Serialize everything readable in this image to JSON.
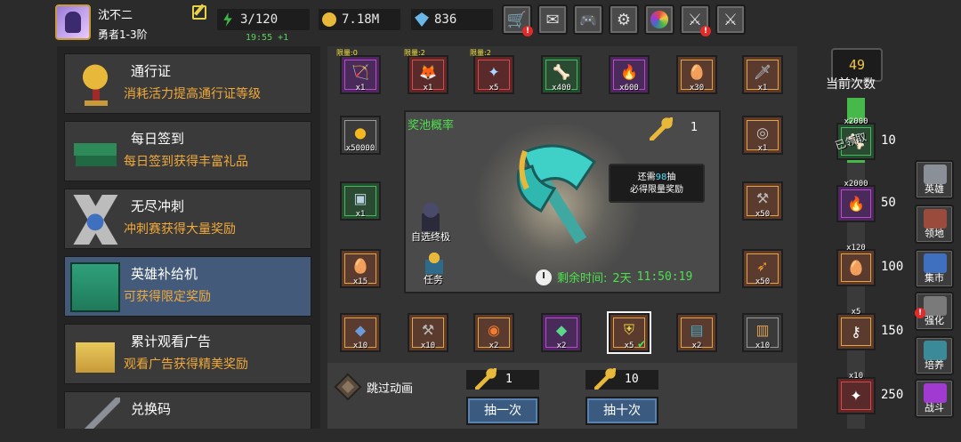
{
  "header": {
    "player_name": "沈不二",
    "player_rank": "勇者1-3阶",
    "energy": "3/120",
    "energy_timer": "19:55 +1",
    "gold": "7.18M",
    "gems": "836",
    "icons": [
      "edit-icon",
      "energy-icon",
      "gold-icon",
      "gem-icon",
      "shop-cart-icon",
      "mail-icon",
      "gamepad-icon",
      "gear-icon",
      "color-wheel-icon",
      "broken-sword-icon",
      "crossed-swords-icon"
    ]
  },
  "menu": {
    "items": [
      {
        "title": "通行证",
        "desc": "消耗活力提高通行证等级"
      },
      {
        "title": "每日签到",
        "desc": "每日签到获得丰富礼品"
      },
      {
        "title": "无尽冲刺",
        "desc": "冲刺赛获得大量奖励"
      },
      {
        "title": "英雄补给机",
        "desc": "可获得限定奖励"
      },
      {
        "title": "累计观看广告",
        "desc": "观看广告获得精美奖励"
      },
      {
        "title": "兑换码",
        "desc": ""
      }
    ]
  },
  "grid": {
    "top": [
      {
        "limit": "限量:0",
        "qty": "x1",
        "rarity": "purple",
        "icon": "crossbow-icon"
      },
      {
        "limit": "限量:2",
        "qty": "x1",
        "rarity": "red",
        "icon": "fox-mask-icon"
      },
      {
        "limit": "限量:2",
        "qty": "x5",
        "rarity": "red",
        "icon": "crystal-icon"
      },
      {
        "limit": "",
        "qty": "x400",
        "rarity": "green",
        "icon": "bone-icon"
      },
      {
        "limit": "",
        "qty": "x600",
        "rarity": "purple",
        "icon": "flame-gem-icon"
      },
      {
        "limit": "",
        "qty": "x30",
        "rarity": "orange",
        "icon": "golden-egg-icon"
      },
      {
        "limit": "",
        "qty": "x1",
        "rarity": "orange",
        "icon": "dagger-icon"
      }
    ],
    "left": [
      {
        "qty": "x50000",
        "rarity": "grey",
        "icon": "gold-coin-icon"
      },
      {
        "qty": "x1",
        "rarity": "green",
        "icon": "treasure-chest-icon"
      },
      {
        "qty": "x15",
        "rarity": "orange",
        "icon": "golden-egg-icon"
      }
    ],
    "right": [
      {
        "qty": "x1",
        "rarity": "orange",
        "icon": "ring-icon"
      },
      {
        "qty": "x50",
        "rarity": "orange",
        "icon": "hammer-icon"
      },
      {
        "qty": "x50",
        "rarity": "orange",
        "icon": "feather-icon"
      }
    ],
    "bottom": [
      {
        "qty": "x10",
        "rarity": "orange",
        "icon": "ore-icon"
      },
      {
        "qty": "x10",
        "rarity": "orange",
        "icon": "hammer-icon"
      },
      {
        "qty": "x2",
        "rarity": "orange",
        "icon": "fire-orb-icon"
      },
      {
        "qty": "x2",
        "rarity": "purple",
        "icon": "green-gem-icon"
      },
      {
        "qty": "x5",
        "rarity": "orange",
        "icon": "shield-icon"
      },
      {
        "qty": "x2",
        "rarity": "orange",
        "icon": "skill-book-icon"
      },
      {
        "qty": "x10",
        "rarity": "grey",
        "icon": "scroll-book-icon"
      }
    ]
  },
  "pool": {
    "title": "奖池概率",
    "key_count": "1",
    "tooltip_prefix": "还需",
    "tooltip_num": "98",
    "tooltip_suffix": "抽",
    "tooltip_line2": "必得限量奖励",
    "char1_label": "自选终极",
    "char2_label": "任务",
    "timer_label": "剩余时间:",
    "timer_days": "2天",
    "timer_value": "11:50:19"
  },
  "actions": {
    "skip_label": "跳过动画",
    "single_cost": "1",
    "ten_cost": "10",
    "single_label": "抽一次",
    "ten_label": "抽十次"
  },
  "progress": {
    "count": "49",
    "count_label": "当前次数",
    "milestones": [
      {
        "num": "10",
        "qty": "x2000",
        "rarity": "green",
        "claimed": "已领取"
      },
      {
        "num": "50",
        "qty": "x2000",
        "rarity": "purple",
        "claimed": ""
      },
      {
        "num": "100",
        "qty": "x120",
        "rarity": "orange",
        "claimed": ""
      },
      {
        "num": "150",
        "qty": "x5",
        "rarity": "orange",
        "claimed": ""
      },
      {
        "num": "250",
        "qty": "x10",
        "rarity": "red",
        "claimed": ""
      }
    ],
    "fill_fraction": 0.196
  },
  "side_nav": [
    {
      "label": "英雄",
      "icon": "knight-helmet-icon",
      "color": "#8a8f98"
    },
    {
      "label": "领地",
      "icon": "castle-icon",
      "color": "#9a4b3b"
    },
    {
      "label": "集市",
      "icon": "market-stall-icon",
      "color": "#3f6fbf"
    },
    {
      "label": "强化",
      "icon": "anvil-icon",
      "color": "#7a7a7a"
    },
    {
      "label": "培养",
      "icon": "pet-egg-icon",
      "color": "#3a8a9a"
    },
    {
      "label": "战斗",
      "icon": "portal-icon",
      "color": "#a03ad0"
    }
  ]
}
